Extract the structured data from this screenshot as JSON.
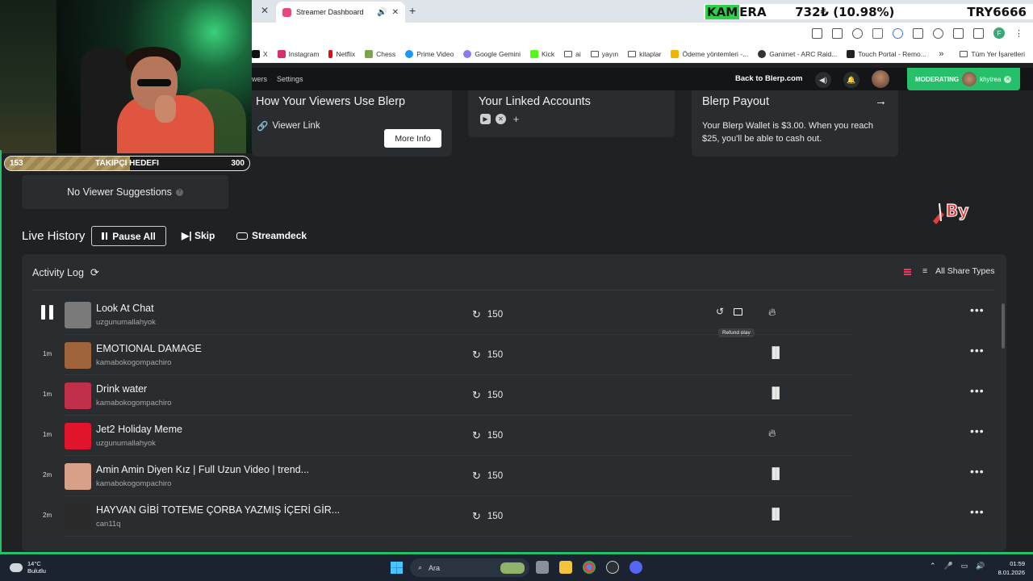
{
  "browser": {
    "tab_title": "Streamer Dashboard",
    "new_tab": "+",
    "bookmarks": [
      "X",
      "Instagram",
      "Netflix",
      "Chess",
      "Prime Video",
      "Google Gemini",
      "Kick",
      "ai",
      "yayın",
      "kitaplar",
      "Ödeme yöntemleri -...",
      "Ganimet - ARC Raid...",
      "Touch Portal - Remo..."
    ],
    "bookmarks_all": "Tüm Yer İşaretleri",
    "profile_initial": "F"
  },
  "ticker": {
    "name_highlight": "KAM",
    "name_rest": "ERA",
    "price": "732₺ (10.98%)",
    "symbol": "TRY6666"
  },
  "goal": {
    "current": "153",
    "label": "TAKIPÇI HEDEFI",
    "max": "300",
    "progress": 0.51
  },
  "header": {
    "nav_partial": "wers",
    "nav_settings": "Settings",
    "back_link": "Back to Blerp.com",
    "moderating_label": "MODERATING",
    "moderating_user": "khytrea"
  },
  "cards": {
    "viewers_title": "How Your Viewers Use Blerp",
    "viewer_link": "Viewer Link",
    "more_info": "More Info",
    "linked_title": "Your Linked Accounts",
    "payout_title": "Blerp Payout",
    "payout_text": "Your Blerp Wallet is $3.00. When you reach $25, you'll be able to cash out."
  },
  "suggestions": "No Viewer Suggestions",
  "live": {
    "title": "Live History",
    "pause_all": "Pause All",
    "skip": "Skip",
    "streamdeck": "Streamdeck"
  },
  "log": {
    "title": "Activity Log",
    "filter": "All Share Types",
    "tooltip": "Refund play",
    "rows": [
      {
        "time": "",
        "title": "Look At Chat",
        "user": "uzgunumallahyok",
        "cost": "150",
        "type": "fire",
        "playing": true,
        "thumb": "#7a7a7a"
      },
      {
        "time": "1m",
        "title": "EMOTIONAL DAMAGE",
        "user": "kamabokogompachiro",
        "cost": "150",
        "type": "bars",
        "playing": false,
        "thumb": "#a0643c"
      },
      {
        "time": "1m",
        "title": "Drink water",
        "user": "kamabokogompachiro",
        "cost": "150",
        "type": "bars",
        "playing": false,
        "thumb": "#c0304a"
      },
      {
        "time": "1m",
        "title": "Jet2 Holiday Meme",
        "user": "uzgunumallahyok",
        "cost": "150",
        "type": "fire",
        "playing": false,
        "thumb": "#e0142a"
      },
      {
        "time": "2m",
        "title": "Amin Amin Diyen Kız | Full Uzun Video | trend...",
        "user": "kamabokogompachiro",
        "cost": "150",
        "type": "bars",
        "playing": false,
        "thumb": "#d8a088"
      },
      {
        "time": "2m",
        "title": "HAYVAN GİBİ TOTEME ÇORBA YAZMIŞ İÇERİ GİR...",
        "user": "can11q",
        "cost": "150",
        "type": "bars",
        "playing": false,
        "thumb": "#2a2a2a"
      }
    ]
  },
  "taskbar": {
    "temp": "14°C",
    "weather": "Bulutlu",
    "search": "Ara",
    "time": "01:59",
    "date": "8.01.2026"
  },
  "colors": {
    "accent_green": "#27c06a",
    "background": "#1f2123",
    "card": "#2a2d30"
  }
}
